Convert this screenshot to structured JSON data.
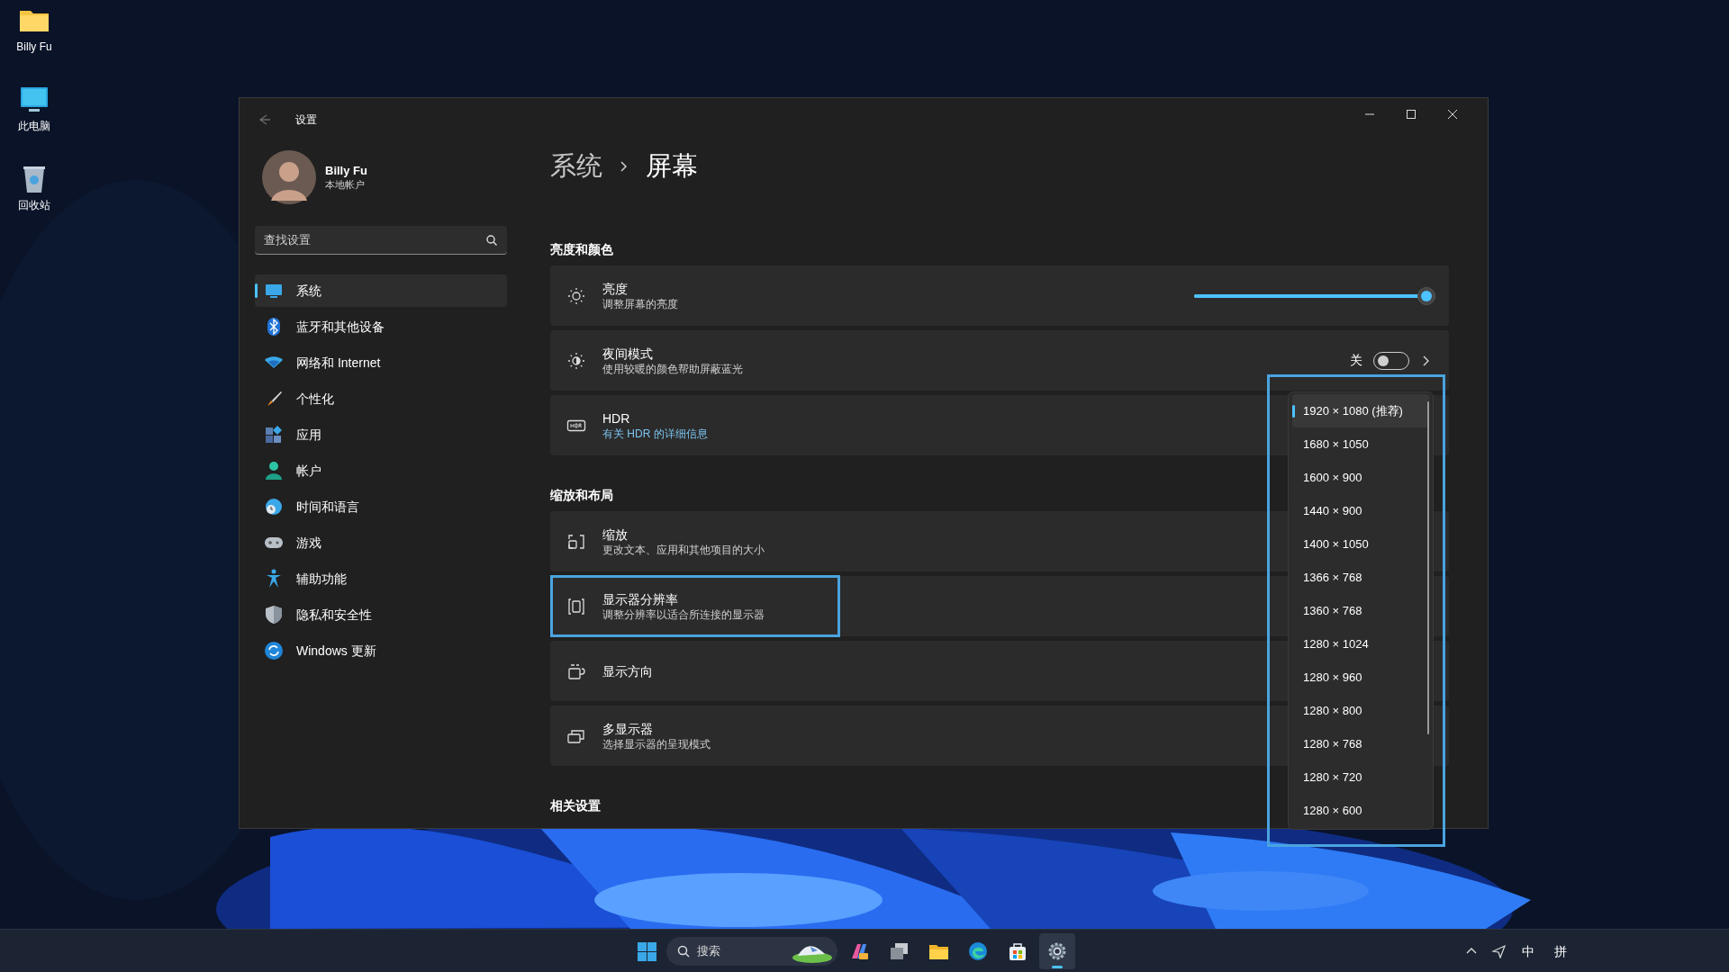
{
  "desktop_icons": [
    {
      "kind": "folder",
      "label": "Billy Fu"
    },
    {
      "kind": "computer",
      "label": "此电脑"
    },
    {
      "kind": "recycle",
      "label": "回收站"
    }
  ],
  "window": {
    "title": "设置",
    "account": {
      "name": "Billy Fu",
      "type": "本地帐户"
    },
    "search": {
      "placeholder": "查找设置"
    },
    "nav": [
      {
        "label": "系统",
        "selected": true
      },
      {
        "label": "蓝牙和其他设备",
        "selected": false
      },
      {
        "label": "网络和 Internet",
        "selected": false
      },
      {
        "label": "个性化",
        "selected": false
      },
      {
        "label": "应用",
        "selected": false
      },
      {
        "label": "帐户",
        "selected": false
      },
      {
        "label": "时间和语言",
        "selected": false
      },
      {
        "label": "游戏",
        "selected": false
      },
      {
        "label": "辅助功能",
        "selected": false
      },
      {
        "label": "隐私和安全性",
        "selected": false
      },
      {
        "label": "Windows 更新",
        "selected": false
      }
    ],
    "breadcrumb": [
      "系统",
      "屏幕"
    ],
    "sections": [
      {
        "title": "亮度和颜色",
        "cards": [
          {
            "kind": "slider",
            "title": "亮度",
            "subtitle": "调整屏幕的亮度",
            "level": 1.0,
            "highlighted": false
          },
          {
            "kind": "toggle",
            "title": "夜间模式",
            "subtitle": "使用较暖的颜色帮助屏蔽蓝光",
            "state_text": "关",
            "on": false,
            "highlighted": false
          },
          {
            "kind": "link",
            "title": "HDR",
            "subtitle": "有关 HDR 的详细信息",
            "highlighted": false
          }
        ]
      },
      {
        "title": "缩放和布局",
        "cards": [
          {
            "kind": "plain",
            "title": "缩放",
            "subtitle": "更改文本、应用和其他项目的大小",
            "highlighted": false
          },
          {
            "kind": "plain",
            "title": "显示器分辨率",
            "subtitle": "调整分辨率以适合所连接的显示器",
            "highlighted": true
          },
          {
            "kind": "plain",
            "title": "显示方向",
            "highlighted": false
          },
          {
            "kind": "plain",
            "title": "多显示器",
            "subtitle": "选择显示器的呈现模式",
            "highlighted": false
          }
        ]
      },
      {
        "title": "相关设置"
      }
    ]
  },
  "dropdown": {
    "highlighted": true,
    "options": [
      {
        "label": "1920 × 1080 (推荐)",
        "selected": true
      },
      {
        "label": "1680 × 1050",
        "selected": false
      },
      {
        "label": "1600 × 900",
        "selected": false
      },
      {
        "label": "1440 × 900",
        "selected": false
      },
      {
        "label": "1400 × 1050",
        "selected": false
      },
      {
        "label": "1366 × 768",
        "selected": false
      },
      {
        "label": "1360 × 768",
        "selected": false
      },
      {
        "label": "1280 × 1024",
        "selected": false
      },
      {
        "label": "1280 × 960",
        "selected": false
      },
      {
        "label": "1280 × 800",
        "selected": false
      },
      {
        "label": "1280 × 768",
        "selected": false
      },
      {
        "label": "1280 × 720",
        "selected": false
      },
      {
        "label": "1280 × 600",
        "selected": false
      }
    ]
  },
  "taskbar": {
    "search": {
      "placeholder": "搜索"
    },
    "apps": [
      {
        "kind": "colorful",
        "active": false
      },
      {
        "kind": "windows",
        "active": false
      },
      {
        "kind": "folder",
        "active": false
      },
      {
        "kind": "browser",
        "active": false
      },
      {
        "kind": "store",
        "active": false
      },
      {
        "kind": "settings",
        "active": true
      }
    ],
    "tray": [
      "中",
      "拼"
    ]
  }
}
